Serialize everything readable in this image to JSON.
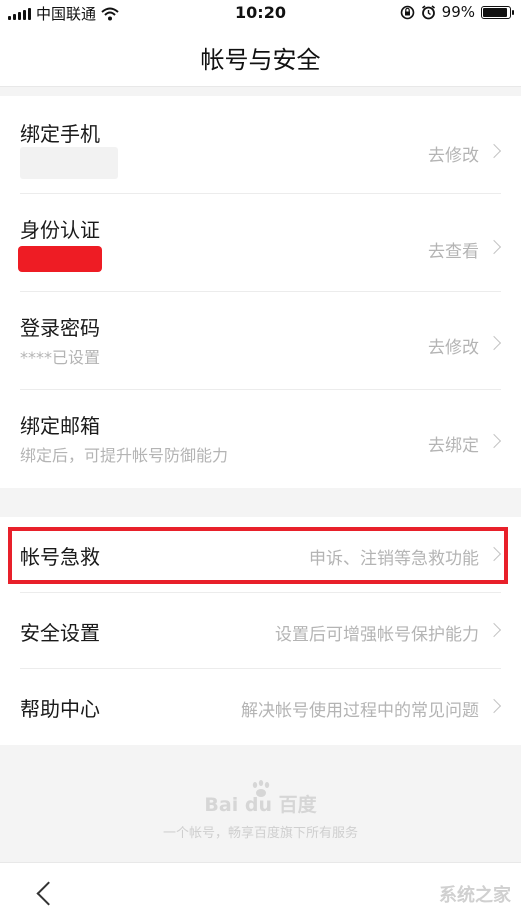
{
  "status_bar": {
    "carrier": "中国联通",
    "time": "10:20",
    "battery": "99%",
    "battery_level": 0.99
  },
  "header": {
    "title": "帐号与安全"
  },
  "account_items": [
    {
      "title": "绑定手机",
      "subtitle": "",
      "action": "去修改"
    },
    {
      "title": "身份认证",
      "subtitle": "",
      "action": "去查看"
    },
    {
      "title": "登录密码",
      "subtitle": "****已设置",
      "action": "去修改"
    },
    {
      "title": "绑定邮箱",
      "subtitle": "绑定后，可提升帐号防御能力",
      "action": "去绑定"
    }
  ],
  "more_items": [
    {
      "title": "帐号急救",
      "action": "申诉、注销等急救功能",
      "highlighted": true
    },
    {
      "title": "安全设置",
      "action": "设置后可增强帐号保护能力"
    },
    {
      "title": "帮助中心",
      "action": "解决帐号使用过程中的常见问题"
    }
  ],
  "footer": {
    "logo": "Bai du 百度",
    "slogan": "一个帐号，畅享百度旗下所有服务"
  },
  "watermark": "系统之家",
  "colors": {
    "highlight": "#e8202a",
    "redaction": "#ee1c24",
    "secondary_text": "#b4b4b4"
  },
  "icons": [
    "signal-icon",
    "wifi-icon",
    "lock-rotation-icon",
    "alarm-icon",
    "battery-icon",
    "chevron-right-icon",
    "back-arrow-icon",
    "baidu-paw-icon"
  ]
}
